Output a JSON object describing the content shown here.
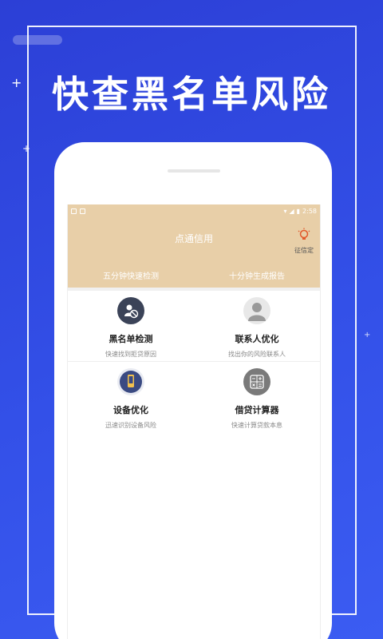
{
  "promo": {
    "headline": "快查黑名单风险"
  },
  "status_bar": {
    "time": "2:58"
  },
  "header": {
    "title": "点通信用",
    "credit_button": {
      "label": "征信定",
      "icon": "lightbulb-icon"
    },
    "tabs": [
      {
        "label": "五分钟快速检测"
      },
      {
        "label": "十分钟生成报告"
      }
    ]
  },
  "features": [
    {
      "title": "黑名单检测",
      "subtitle": "快速找到拒贷原因",
      "icon": "blacklist-person-icon"
    },
    {
      "title": "联系人优化",
      "subtitle": "找出你的风险联系人",
      "icon": "contact-avatar-icon"
    },
    {
      "title": "设备优化",
      "subtitle": "迅速识别设备风险",
      "icon": "phone-device-icon"
    },
    {
      "title": "借贷计算器",
      "subtitle": "快速计算贷款本息",
      "icon": "calculator-icon"
    }
  ],
  "colors": {
    "background": "#3350e8",
    "header": "#e8cfa8",
    "accent": "#e2582a"
  }
}
